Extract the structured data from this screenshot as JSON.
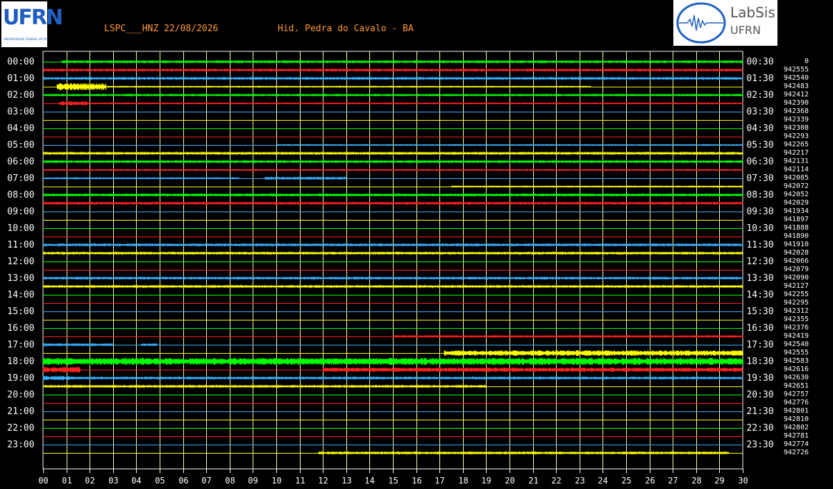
{
  "header": {
    "station_text": "LSPC___HNZ 22/08/2026",
    "location_text": "Hid. Pedra do Cavalo - BA"
  },
  "logos": {
    "left_text": "UFRN",
    "left_subtext": "UNIVERSIDADE FEDERAL DO RIO GRANDE DO NORTE",
    "right_line1": "LabSis",
    "right_line2": "UFRN"
  },
  "chart_data": {
    "type": "line",
    "title": "LSPC___HNZ 22/08/2026",
    "subtitle": "Hid. Pedra do Cavalo - BA",
    "x_ticks": [
      "00",
      "01",
      "02",
      "03",
      "04",
      "05",
      "06",
      "07",
      "08",
      "09",
      "10",
      "11",
      "12",
      "13",
      "14",
      "15",
      "16",
      "17",
      "18",
      "19",
      "20",
      "21",
      "22",
      "23",
      "24",
      "25",
      "26",
      "27",
      "28",
      "29",
      "30"
    ],
    "xlim": [
      0,
      30
    ],
    "left_time_labels": [
      "00:00",
      "01:00",
      "02:00",
      "03:00",
      "04:00",
      "05:00",
      "06:00",
      "07:00",
      "08:00",
      "09:00",
      "10:00",
      "11:00",
      "12:00",
      "13:00",
      "14:00",
      "15:00",
      "16:00",
      "17:00",
      "18:00",
      "19:00",
      "20:00",
      "21:00",
      "22:00",
      "23:00"
    ],
    "right_time_labels": [
      "00:30",
      "01:30",
      "02:30",
      "03:30",
      "04:30",
      "05:30",
      "06:30",
      "07:30",
      "08:30",
      "09:30",
      "10:30",
      "11:30",
      "12:30",
      "13:30",
      "14:30",
      "15:30",
      "16:30",
      "17:30",
      "18:30",
      "19:30",
      "20:30",
      "21:30",
      "22:30",
      "23:30"
    ],
    "row_values": [
      "0",
      "942555",
      "942540",
      "942483",
      "942412",
      "942390",
      "942368",
      "942339",
      "942308",
      "942293",
      "942265",
      "942217",
      "942131",
      "942114",
      "942085",
      "942072",
      "942052",
      "942029",
      "941934",
      "941897",
      "941888",
      "941890",
      "941910",
      "942028",
      "942066",
      "942079",
      "942090",
      "942127",
      "942255",
      "942295",
      "942312",
      "942355",
      "942376",
      "942419",
      "942540",
      "942555",
      "942583",
      "942616",
      "942630",
      "942651",
      "942757",
      "942776",
      "942801",
      "942810",
      "942802",
      "942781",
      "942774",
      "942726"
    ],
    "trace_colors": [
      "#00ff00",
      "#ff2020",
      "#3ab0ff",
      "#ffff00"
    ],
    "grid_color": "#ffffaa",
    "grid": true,
    "traces": [
      {
        "row": 0,
        "segments": [
          [
            0.8,
            30,
            1
          ]
        ]
      },
      {
        "row": 1,
        "segments": [
          [
            0,
            30,
            1
          ]
        ]
      },
      {
        "row": 2,
        "segments": [
          [
            0,
            30,
            1
          ]
        ]
      },
      {
        "row": 3,
        "segments": [
          [
            0.6,
            2.7,
            5
          ],
          [
            2.7,
            23.5,
            0.5
          ]
        ]
      },
      {
        "row": 4,
        "segments": [
          [
            0,
            30,
            0.8
          ]
        ]
      },
      {
        "row": 5,
        "segments": [
          [
            0.7,
            1.9,
            3
          ],
          [
            1.9,
            30,
            0.5
          ]
        ]
      },
      {
        "row": 10,
        "segments": [
          [
            10,
            30,
            0.5
          ]
        ]
      },
      {
        "row": 11,
        "segments": [
          [
            0,
            30,
            1.2
          ]
        ]
      },
      {
        "row": 12,
        "segments": [
          [
            0,
            30,
            1
          ]
        ]
      },
      {
        "row": 13,
        "segments": [
          [
            0,
            30,
            0.6
          ]
        ]
      },
      {
        "row": 14,
        "segments": [
          [
            0,
            8.4,
            0.6
          ],
          [
            9.5,
            13,
            1
          ]
        ]
      },
      {
        "row": 15,
        "segments": [
          [
            17.5,
            30,
            0.6
          ]
        ]
      },
      {
        "row": 16,
        "segments": [
          [
            0,
            30,
            1.2
          ]
        ]
      },
      {
        "row": 17,
        "segments": [
          [
            0,
            30,
            1.5
          ]
        ]
      },
      {
        "row": 22,
        "segments": [
          [
            0,
            30,
            1.2
          ]
        ]
      },
      {
        "row": 23,
        "segments": [
          [
            0,
            30,
            1.2
          ]
        ]
      },
      {
        "row": 26,
        "segments": [
          [
            0,
            30,
            1
          ]
        ]
      },
      {
        "row": 27,
        "segments": [
          [
            0,
            30,
            1
          ]
        ]
      },
      {
        "row": 33,
        "segments": [
          [
            15,
            30,
            0.8
          ]
        ]
      },
      {
        "row": 34,
        "segments": [
          [
            0,
            3,
            1
          ],
          [
            4.2,
            4.9,
            1
          ]
        ]
      },
      {
        "row": 35,
        "segments": [
          [
            17.2,
            30,
            4
          ]
        ]
      },
      {
        "row": 36,
        "segments": [
          [
            0,
            30,
            5
          ]
        ]
      },
      {
        "row": 37,
        "segments": [
          [
            0,
            1.6,
            4
          ],
          [
            12,
            30,
            3
          ]
        ]
      },
      {
        "row": 38,
        "segments": [
          [
            0,
            1.3,
            3
          ],
          [
            1.3,
            30,
            1
          ]
        ]
      },
      {
        "row": 39,
        "segments": [
          [
            0,
            19,
            1
          ]
        ]
      },
      {
        "row": 47,
        "segments": [
          [
            11.8,
            29.4,
            1
          ]
        ]
      }
    ]
  }
}
